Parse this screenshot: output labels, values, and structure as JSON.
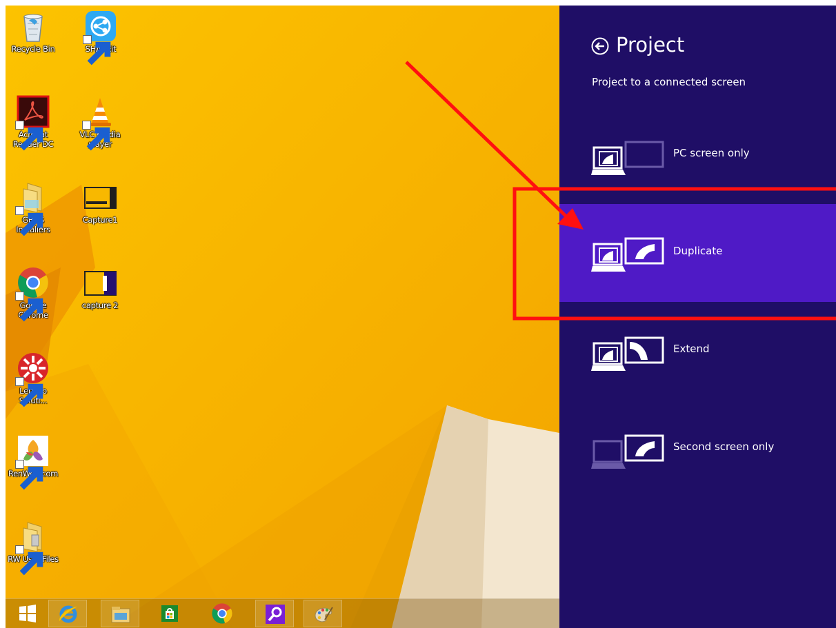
{
  "desktop": {
    "icons": [
      {
        "label": "Recycle Bin",
        "icon": "recycle-bin-icon"
      },
      {
        "label": "SHAREit",
        "icon": "shareit-icon"
      },
      {
        "label": "Acrobat Reader DC",
        "icon": "acrobat-reader-icon"
      },
      {
        "label": "VLC media player",
        "icon": "vlc-icon"
      },
      {
        "label": "GBDS Installers",
        "icon": "folder-icon"
      },
      {
        "label": "Capture1",
        "icon": "image-thumbnail-icon"
      },
      {
        "label": "Google Chrome",
        "icon": "chrome-icon"
      },
      {
        "label": "capture 2",
        "icon": "image-thumbnail-icon"
      },
      {
        "label": "Lenovo Soluti...",
        "icon": "lenovo-solutions-icon"
      },
      {
        "label": "RenWeb.com",
        "icon": "renweb-icon"
      },
      {
        "label": "RW User Files",
        "icon": "folder-icon"
      }
    ]
  },
  "taskbar": {
    "items": [
      {
        "icon": "windows-start-icon"
      },
      {
        "icon": "internet-explorer-icon"
      },
      {
        "icon": "file-explorer-icon"
      },
      {
        "icon": "store-icon"
      },
      {
        "icon": "chrome-icon"
      },
      {
        "icon": "search-magnifier-icon"
      },
      {
        "icon": "paint-icon"
      }
    ]
  },
  "project_panel": {
    "title": "Project",
    "subtitle": "Project to a connected screen",
    "options": [
      {
        "label": "PC screen only",
        "selected": false
      },
      {
        "label": "Duplicate",
        "selected": true
      },
      {
        "label": "Extend",
        "selected": false
      },
      {
        "label": "Second screen only",
        "selected": false
      }
    ]
  },
  "colors": {
    "panel_background": "#1f0e66",
    "selected_option": "#4f1ac6",
    "desktop_background": "#f7b800",
    "annotation": "#ff0000"
  }
}
